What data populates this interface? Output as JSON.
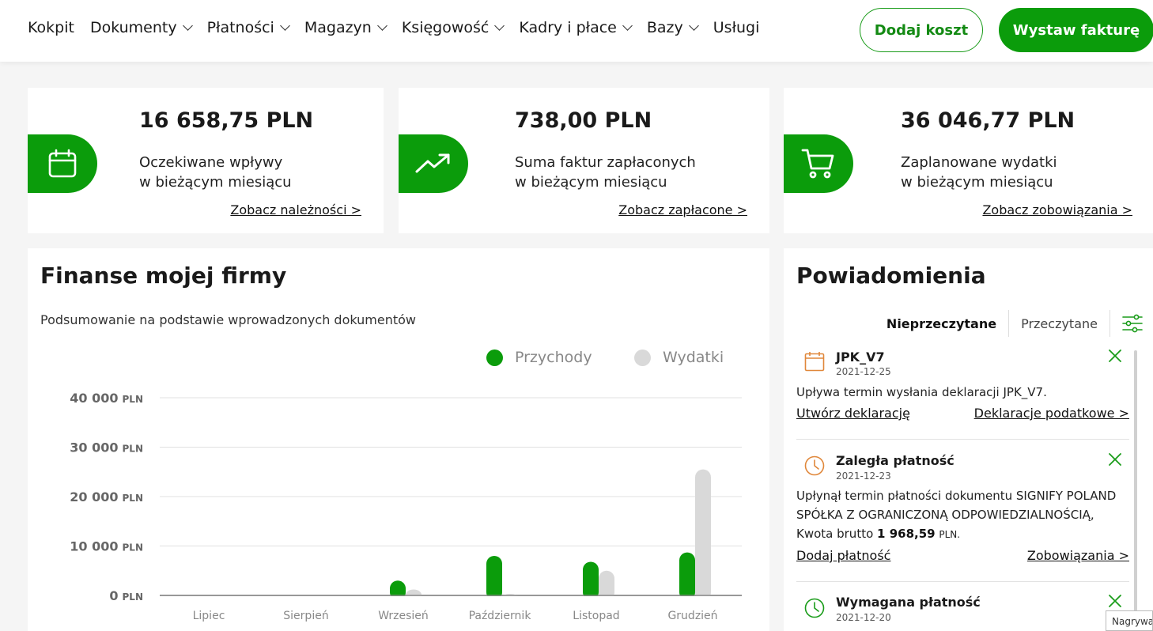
{
  "nav": {
    "items": [
      {
        "label": "Kokpit",
        "dropdown": false
      },
      {
        "label": "Dokumenty",
        "dropdown": true
      },
      {
        "label": "Płatności",
        "dropdown": true
      },
      {
        "label": "Magazyn",
        "dropdown": true
      },
      {
        "label": "Księgowość",
        "dropdown": true
      },
      {
        "label": "Kadry i płace",
        "dropdown": true
      },
      {
        "label": "Bazy",
        "dropdown": true
      },
      {
        "label": "Usługi",
        "dropdown": false
      }
    ],
    "add_cost_label": "Dodaj koszt",
    "issue_invoice_label": "Wystaw fakturę"
  },
  "stats": [
    {
      "amount": "16 658,75 PLN",
      "desc_line1": "Oczekiwane wpływy",
      "desc_line2": "w bieżącym miesiącu",
      "link": "Zobacz należności >",
      "icon": "calendar-icon"
    },
    {
      "amount": "738,00 PLN",
      "desc_line1": "Suma faktur zapłaconych",
      "desc_line2": "w bieżącym miesiącu",
      "link": "Zobacz zapłacone >",
      "icon": "trend-up-icon"
    },
    {
      "amount": "36 046,77 PLN",
      "desc_line1": "Zaplanowane wydatki",
      "desc_line2": "w bieżącym miesiącu",
      "link": "Zobacz zobowiązania >",
      "icon": "cart-icon"
    }
  ],
  "finance": {
    "title": "Finanse mojej firmy",
    "subtitle": "Podsumowanie na podstawie wprowadzonych dokumentów"
  },
  "chart_data": {
    "type": "bar",
    "categories": [
      "Lipiec",
      "Sierpień",
      "Wrzesień",
      "Październik",
      "Listopad",
      "Grudzień"
    ],
    "series": [
      {
        "name": "Przychody",
        "color": "#0b9c0b",
        "values": [
          0,
          0,
          3000,
          8000,
          6800,
          8700
        ]
      },
      {
        "name": "Wydatki",
        "color": "#d9d9d9",
        "values": [
          0,
          0,
          1200,
          300,
          5000,
          25500
        ]
      }
    ],
    "ticks": [
      {
        "value": 0,
        "num": "0",
        "unit": "PLN"
      },
      {
        "value": 10000,
        "num": "10 000",
        "unit": "PLN"
      },
      {
        "value": 20000,
        "num": "20 000",
        "unit": "PLN"
      },
      {
        "value": 30000,
        "num": "30 000",
        "unit": "PLN"
      },
      {
        "value": 40000,
        "num": "40 000",
        "unit": "PLN"
      }
    ],
    "ylim": [
      0,
      40000
    ],
    "grid": true,
    "legend_position": "top-right"
  },
  "notifications": {
    "title": "Powiadomienia",
    "tabs": {
      "unread": "Nieprzeczytane",
      "read": "Przeczytane"
    },
    "items": [
      {
        "icon": "calendar-icon",
        "icon_color": "#e0873a",
        "title": "JPK_V7",
        "date": "2021-12-25",
        "body": "Upływa termin wysłania deklaracji JPK_V7.",
        "link_left": "Utwórz deklarację",
        "link_right": "Deklaracje podatkowe >"
      },
      {
        "icon": "clock-icon",
        "icon_color": "#e0873a",
        "title": "Zaległa płatność",
        "date": "2021-12-23",
        "body": "Upłynął termin płatności dokumentu SIGNIFY POLAND SPÓŁKA Z OGRANICZONĄ ODPOWIEDZIALNOŚCIĄ, Kwota brutto ",
        "amount": "1 968,59",
        "unit": "PLN.",
        "link_left": "Dodaj płatność",
        "link_right": "Zobowiązania >"
      },
      {
        "icon": "clock-icon",
        "icon_color": "#1a9c1a",
        "title": "Wymagana płatność",
        "date": "2021-12-20"
      }
    ]
  },
  "tooltip": "Nagrywa"
}
